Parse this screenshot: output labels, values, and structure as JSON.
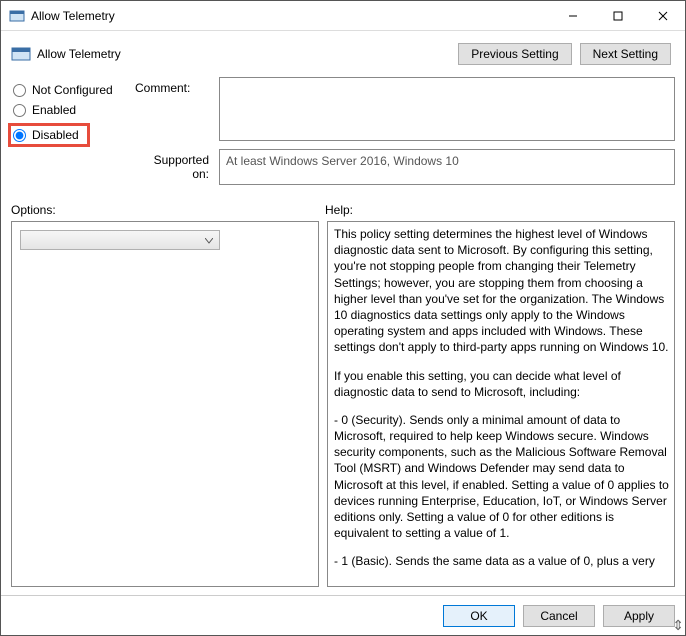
{
  "window": {
    "title": "Allow Telemetry",
    "header_title": "Allow Telemetry"
  },
  "nav": {
    "previous": "Previous Setting",
    "next": "Next Setting"
  },
  "radios": {
    "not_configured": "Not Configured",
    "enabled": "Enabled",
    "disabled": "Disabled",
    "selected": "disabled"
  },
  "labels": {
    "comment": "Comment:",
    "supported": "Supported on:",
    "options": "Options:",
    "help": "Help:"
  },
  "fields": {
    "comment": "",
    "supported": "At least Windows Server 2016, Windows 10"
  },
  "help": {
    "p1": "This policy setting determines the highest level of Windows diagnostic data sent to Microsoft. By configuring this setting, you're not stopping people from changing their Telemetry Settings; however, you are stopping them from choosing a higher level than you've set for the organization. The Windows 10 diagnostics data settings only apply to the Windows operating system and apps included with Windows. These settings don't apply to third-party apps running on Windows 10.",
    "p2": "If you enable this setting, you can decide what level of diagnostic data to send to Microsoft, including:",
    "p3": "  - 0 (Security). Sends only a minimal amount of data to Microsoft, required to help keep Windows secure. Windows security components, such as the Malicious Software Removal Tool (MSRT) and Windows Defender may send data to Microsoft at this level, if enabled. Setting a value of 0 applies to devices running Enterprise, Education, IoT, or Windows Server editions only. Setting a value of 0 for other editions is equivalent to setting a value of 1.",
    "p4": "  - 1 (Basic). Sends the same data as a value of 0, plus a very"
  },
  "footer": {
    "ok": "OK",
    "cancel": "Cancel",
    "apply": "Apply"
  }
}
